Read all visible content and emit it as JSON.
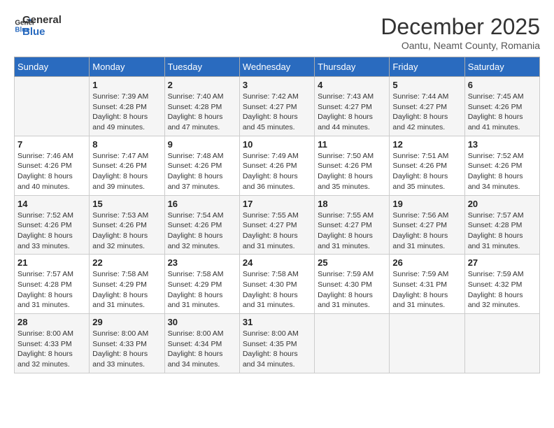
{
  "logo": {
    "line1": "General",
    "line2": "Blue"
  },
  "title": "December 2025",
  "subtitle": "Oantu, Neamt County, Romania",
  "days_of_week": [
    "Sunday",
    "Monday",
    "Tuesday",
    "Wednesday",
    "Thursday",
    "Friday",
    "Saturday"
  ],
  "weeks": [
    [
      {
        "day": "",
        "info": ""
      },
      {
        "day": "1",
        "info": "Sunrise: 7:39 AM\nSunset: 4:28 PM\nDaylight: 8 hours\nand 49 minutes."
      },
      {
        "day": "2",
        "info": "Sunrise: 7:40 AM\nSunset: 4:28 PM\nDaylight: 8 hours\nand 47 minutes."
      },
      {
        "day": "3",
        "info": "Sunrise: 7:42 AM\nSunset: 4:27 PM\nDaylight: 8 hours\nand 45 minutes."
      },
      {
        "day": "4",
        "info": "Sunrise: 7:43 AM\nSunset: 4:27 PM\nDaylight: 8 hours\nand 44 minutes."
      },
      {
        "day": "5",
        "info": "Sunrise: 7:44 AM\nSunset: 4:27 PM\nDaylight: 8 hours\nand 42 minutes."
      },
      {
        "day": "6",
        "info": "Sunrise: 7:45 AM\nSunset: 4:26 PM\nDaylight: 8 hours\nand 41 minutes."
      }
    ],
    [
      {
        "day": "7",
        "info": "Sunrise: 7:46 AM\nSunset: 4:26 PM\nDaylight: 8 hours\nand 40 minutes."
      },
      {
        "day": "8",
        "info": "Sunrise: 7:47 AM\nSunset: 4:26 PM\nDaylight: 8 hours\nand 39 minutes."
      },
      {
        "day": "9",
        "info": "Sunrise: 7:48 AM\nSunset: 4:26 PM\nDaylight: 8 hours\nand 37 minutes."
      },
      {
        "day": "10",
        "info": "Sunrise: 7:49 AM\nSunset: 4:26 PM\nDaylight: 8 hours\nand 36 minutes."
      },
      {
        "day": "11",
        "info": "Sunrise: 7:50 AM\nSunset: 4:26 PM\nDaylight: 8 hours\nand 35 minutes."
      },
      {
        "day": "12",
        "info": "Sunrise: 7:51 AM\nSunset: 4:26 PM\nDaylight: 8 hours\nand 35 minutes."
      },
      {
        "day": "13",
        "info": "Sunrise: 7:52 AM\nSunset: 4:26 PM\nDaylight: 8 hours\nand 34 minutes."
      }
    ],
    [
      {
        "day": "14",
        "info": "Sunrise: 7:52 AM\nSunset: 4:26 PM\nDaylight: 8 hours\nand 33 minutes."
      },
      {
        "day": "15",
        "info": "Sunrise: 7:53 AM\nSunset: 4:26 PM\nDaylight: 8 hours\nand 32 minutes."
      },
      {
        "day": "16",
        "info": "Sunrise: 7:54 AM\nSunset: 4:26 PM\nDaylight: 8 hours\nand 32 minutes."
      },
      {
        "day": "17",
        "info": "Sunrise: 7:55 AM\nSunset: 4:27 PM\nDaylight: 8 hours\nand 31 minutes."
      },
      {
        "day": "18",
        "info": "Sunrise: 7:55 AM\nSunset: 4:27 PM\nDaylight: 8 hours\nand 31 minutes."
      },
      {
        "day": "19",
        "info": "Sunrise: 7:56 AM\nSunset: 4:27 PM\nDaylight: 8 hours\nand 31 minutes."
      },
      {
        "day": "20",
        "info": "Sunrise: 7:57 AM\nSunset: 4:28 PM\nDaylight: 8 hours\nand 31 minutes."
      }
    ],
    [
      {
        "day": "21",
        "info": "Sunrise: 7:57 AM\nSunset: 4:28 PM\nDaylight: 8 hours\nand 31 minutes."
      },
      {
        "day": "22",
        "info": "Sunrise: 7:58 AM\nSunset: 4:29 PM\nDaylight: 8 hours\nand 31 minutes."
      },
      {
        "day": "23",
        "info": "Sunrise: 7:58 AM\nSunset: 4:29 PM\nDaylight: 8 hours\nand 31 minutes."
      },
      {
        "day": "24",
        "info": "Sunrise: 7:58 AM\nSunset: 4:30 PM\nDaylight: 8 hours\nand 31 minutes."
      },
      {
        "day": "25",
        "info": "Sunrise: 7:59 AM\nSunset: 4:30 PM\nDaylight: 8 hours\nand 31 minutes."
      },
      {
        "day": "26",
        "info": "Sunrise: 7:59 AM\nSunset: 4:31 PM\nDaylight: 8 hours\nand 31 minutes."
      },
      {
        "day": "27",
        "info": "Sunrise: 7:59 AM\nSunset: 4:32 PM\nDaylight: 8 hours\nand 32 minutes."
      }
    ],
    [
      {
        "day": "28",
        "info": "Sunrise: 8:00 AM\nSunset: 4:33 PM\nDaylight: 8 hours\nand 32 minutes."
      },
      {
        "day": "29",
        "info": "Sunrise: 8:00 AM\nSunset: 4:33 PM\nDaylight: 8 hours\nand 33 minutes."
      },
      {
        "day": "30",
        "info": "Sunrise: 8:00 AM\nSunset: 4:34 PM\nDaylight: 8 hours\nand 34 minutes."
      },
      {
        "day": "31",
        "info": "Sunrise: 8:00 AM\nSunset: 4:35 PM\nDaylight: 8 hours\nand 34 minutes."
      },
      {
        "day": "",
        "info": ""
      },
      {
        "day": "",
        "info": ""
      },
      {
        "day": "",
        "info": ""
      }
    ]
  ]
}
